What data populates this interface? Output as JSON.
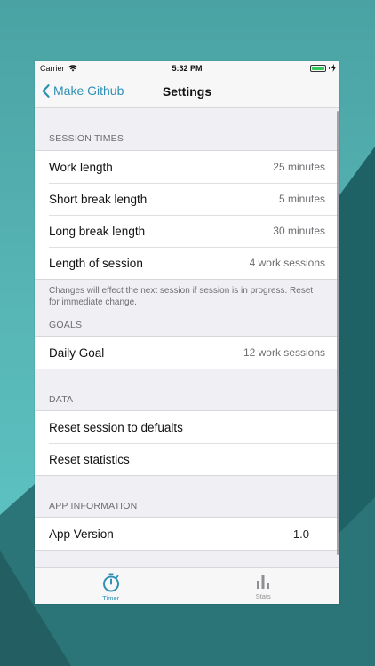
{
  "status_bar": {
    "carrier": "Carrier",
    "time": "5:32 PM"
  },
  "nav": {
    "back_label": "Make Github",
    "title": "Settings"
  },
  "sections": {
    "session_times": {
      "header": "SESSION TIMES",
      "rows": [
        {
          "label": "Work length",
          "value": "25 minutes"
        },
        {
          "label": "Short break length",
          "value": "5 minutes"
        },
        {
          "label": "Long break length",
          "value": "30 minutes"
        },
        {
          "label": "Length of session",
          "value": "4 work sessions"
        }
      ],
      "footer": "Changes will effect the next session if session is in progress. Reset for immediate change."
    },
    "goals": {
      "header": "GOALS",
      "rows": [
        {
          "label": "Daily Goal",
          "value": "12 work sessions"
        }
      ]
    },
    "data": {
      "header": "DATA",
      "rows": [
        {
          "label": "Reset session to defualts"
        },
        {
          "label": "Reset statistics"
        }
      ]
    },
    "app_information": {
      "header": "APP INFORMATION",
      "rows": [
        {
          "label": "App Version",
          "value": "1.0"
        }
      ]
    }
  },
  "tabs": [
    {
      "label": "Timer",
      "icon": "stopwatch-icon",
      "active": true
    },
    {
      "label": "Stats",
      "icon": "bar-chart-icon",
      "active": false
    }
  ],
  "colors": {
    "accent": "#2f8fb5",
    "background": "#efeff4",
    "secondary_text": "#6d6d72",
    "battery": "#34c759"
  }
}
